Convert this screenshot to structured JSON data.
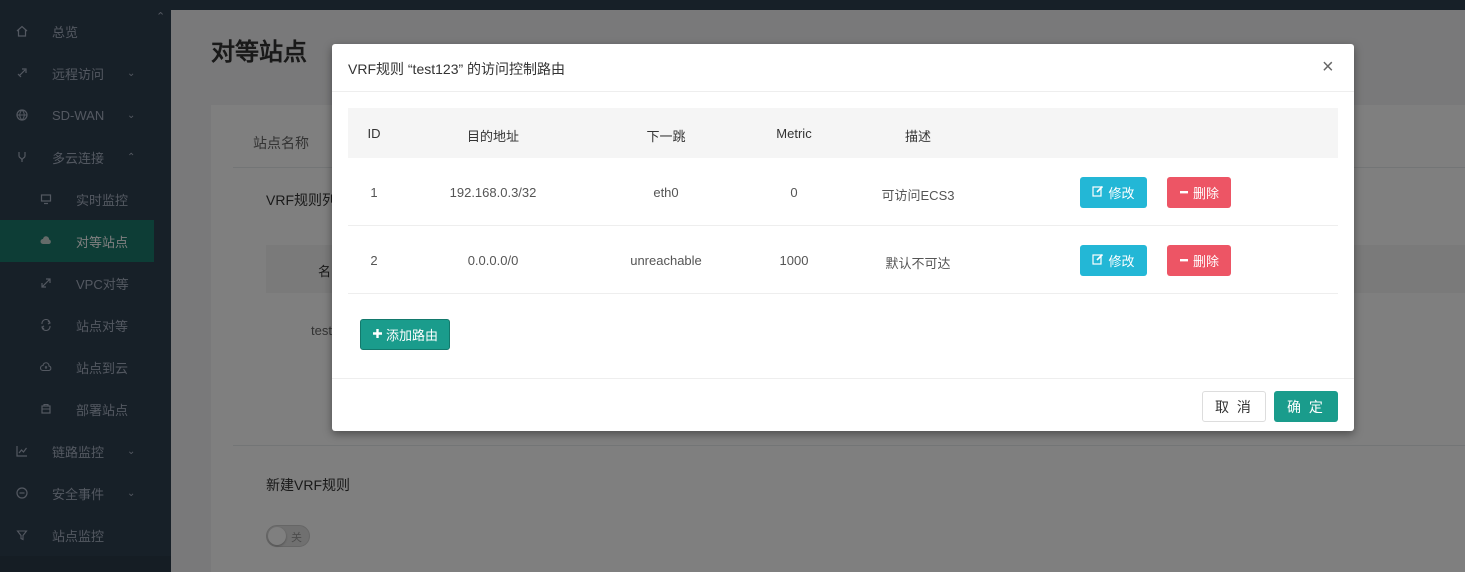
{
  "sidebar": {
    "items": [
      {
        "label": "总览",
        "icon": "home-icon",
        "chevron": ""
      },
      {
        "label": "远程访问",
        "icon": "rocket-icon",
        "chevron": "⌄"
      },
      {
        "label": "SD-WAN",
        "icon": "globe-icon",
        "chevron": "⌄"
      },
      {
        "label": "多云连接",
        "icon": "branch-icon",
        "chevron": "⌃"
      },
      {
        "label": "实时监控",
        "icon": "monitor-icon",
        "chevron": ""
      },
      {
        "label": "对等站点",
        "icon": "cloud-icon",
        "chevron": ""
      },
      {
        "label": "VPC对等",
        "icon": "expand-icon",
        "chevron": ""
      },
      {
        "label": "站点对等",
        "icon": "refresh-icon",
        "chevron": ""
      },
      {
        "label": "站点到云",
        "icon": "cloud-upload-icon",
        "chevron": ""
      },
      {
        "label": "部署站点",
        "icon": "box-icon",
        "chevron": ""
      },
      {
        "label": "链路监控",
        "icon": "chart-icon",
        "chevron": "⌄"
      },
      {
        "label": "安全事件",
        "icon": "minus-circle-icon",
        "chevron": "⌄"
      },
      {
        "label": "站点监控",
        "icon": "filter-icon",
        "chevron": ""
      }
    ]
  },
  "page": {
    "title": "对等站点",
    "site_name_label": "站点名称",
    "vrf_list_label": "VRF规则列",
    "inner_head_fragment": "名",
    "row_fragment": "test",
    "new_vrf_label": "新建VRF规则",
    "toggle_text": "关"
  },
  "modal": {
    "title": "VRF规则 “test123” 的访问控制路由",
    "close": "×",
    "columns": {
      "id": "ID",
      "dst": "目的地址",
      "next_hop": "下一跳",
      "metric": "Metric",
      "desc": "描述"
    },
    "rows": [
      {
        "id": "1",
        "dst": "192.168.0.3/32",
        "next_hop": "eth0",
        "metric": "0",
        "desc": "可访问ECS3"
      },
      {
        "id": "2",
        "dst": "0.0.0.0/0",
        "next_hop": "unreachable",
        "metric": "1000",
        "desc": "默认不可达"
      }
    ],
    "edit_label": "修改",
    "delete_label": "删除",
    "add_route_label": "添加路由",
    "cancel_label": "取 消",
    "ok_label": "确 定"
  },
  "colors": {
    "sidebar_bg": "#2f4050",
    "active_bg": "#1a7a6c",
    "primary": "#1a9c8c",
    "edit": "#23b7d6",
    "danger": "#ed5565"
  }
}
